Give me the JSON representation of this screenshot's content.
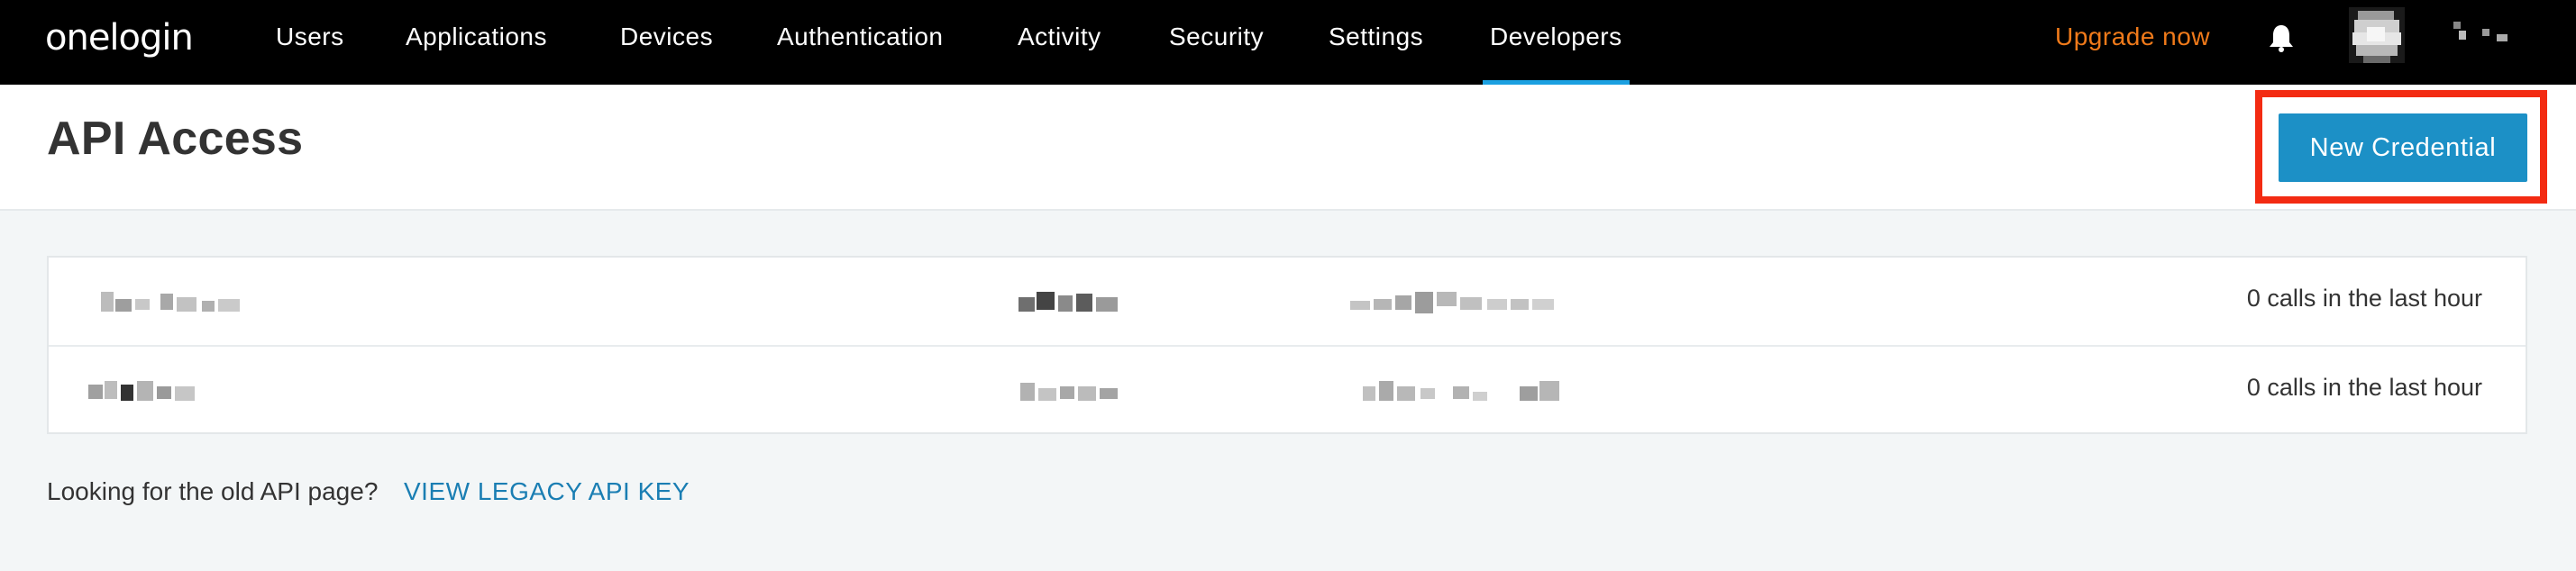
{
  "nav": {
    "logo": "onelogin",
    "items": [
      {
        "label": "Users"
      },
      {
        "label": "Applications"
      },
      {
        "label": "Devices"
      },
      {
        "label": "Authentication"
      },
      {
        "label": "Activity"
      },
      {
        "label": "Security"
      },
      {
        "label": "Settings"
      },
      {
        "label": "Developers",
        "active": true
      }
    ],
    "upgrade_label": "Upgrade now",
    "bell_icon": "bell-icon",
    "avatar_icon": "avatar"
  },
  "header": {
    "title": "API Access",
    "new_credential_label": "New Credential"
  },
  "credentials": [
    {
      "name": "",
      "scope": "",
      "client_id": "",
      "calls": "0 calls in the last hour"
    },
    {
      "name": "",
      "scope": "",
      "client_id": "",
      "calls": "0 calls in the last hour"
    }
  ],
  "footer": {
    "prompt": "Looking for the old API page?",
    "legacy_link": "VIEW LEGACY API KEY"
  },
  "colors": {
    "nav_bg": "#000000",
    "accent": "#1ba0e1",
    "button": "#1c90c6",
    "upgrade": "#f07a1a",
    "highlight": "#f32b12",
    "link": "#1a7eb3"
  }
}
